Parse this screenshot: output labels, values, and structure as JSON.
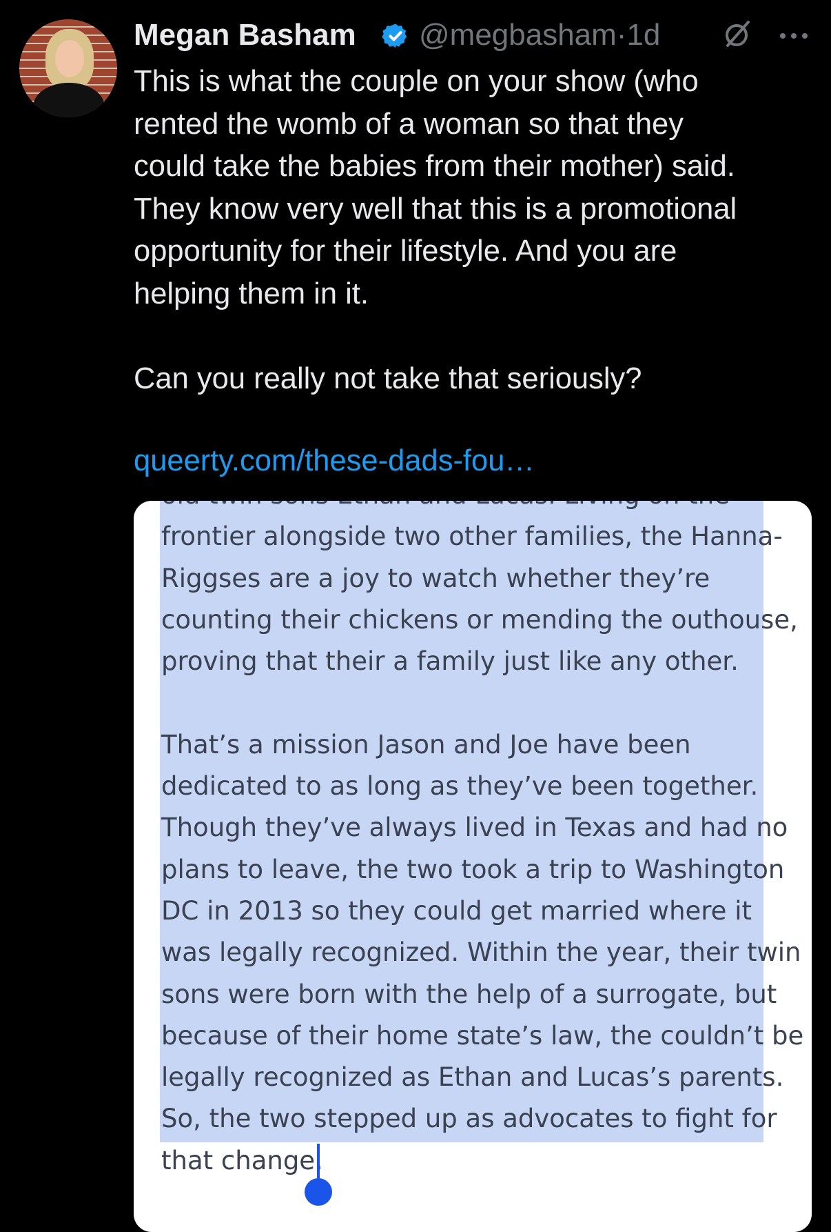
{
  "tweet": {
    "author_name": "Megan Basham",
    "handle": "@megbasham",
    "separator": "·",
    "time": "1d",
    "verified_icon": "verified-badge-icon",
    "accent_color": "#1d9bf0",
    "text": "This is what the couple on your show (who\nrented the womb of a woman so that they\ncould take the babies from their mother) said.\nThey know very well that this is a promotional\nopportunity for their lifestyle. And you are\nhelping them in it.\n\nCan you really not take that seriously?",
    "link": "queerty.com/these-dads-fou…"
  },
  "image": {
    "lines": [
      "old twin sons Ethan and Lucas. Living on the",
      "frontier alongside two other families, the Hanna-",
      "Riggses are a joy to watch whether they’re",
      "counting their chickens or mending the outhouse,",
      "proving that their a family just like any other.",
      "",
      "That’s a mission Jason and Joe have been",
      "dedicated to as long as they’ve been together.",
      "Though they’ve always lived in Texas and had no",
      "plans to leave, the two took a trip to Washington",
      "DC in 2013 so they could get married where it",
      "was legally recognized. Within the year, their twin",
      "sons were born with the help of a surrogate, but",
      "because of their home state’s law, the couldn’t be",
      "legally recognized as Ethan and Lucas’s parents.",
      "So, the two stepped up as advocates to fight for",
      "that change."
    ],
    "selection_color": "#c7d6f4",
    "caret_color": "#1a54e8"
  }
}
